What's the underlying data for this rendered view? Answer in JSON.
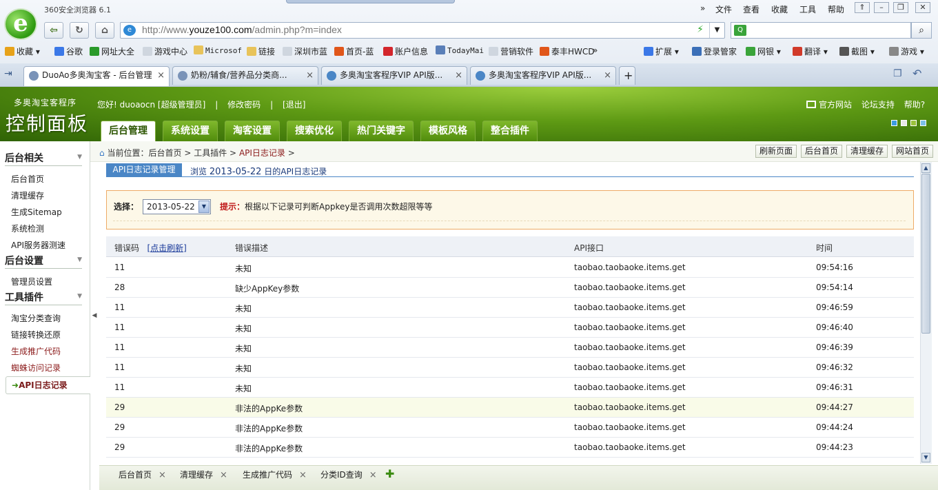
{
  "browser": {
    "app_title": "360安全浏览器 6.1",
    "menu": [
      "文件",
      "查看",
      "收藏",
      "工具",
      "帮助"
    ],
    "menu_more": "»",
    "url_gray_prefix": "http://www.",
    "url_host": "youze100.com",
    "url_path": "/admin.php?m=index",
    "bookmarks": [
      {
        "label": "收藏",
        "icon": "star-icon",
        "color": "#e7a21a"
      },
      {
        "label": "谷歌",
        "icon": "google-icon",
        "color": "#3b78e7"
      },
      {
        "label": "网址大全",
        "icon": "sites-icon",
        "color": "#2a9a2a"
      },
      {
        "label": "游戏中心",
        "icon": "page-icon",
        "color": "#cfd6df"
      },
      {
        "label": "Microsof",
        "icon": "folder-icon",
        "color": "#e8c35a"
      },
      {
        "label": "链接",
        "icon": "folder-icon",
        "color": "#e8c35a"
      },
      {
        "label": "深圳市蓝",
        "icon": "page-icon",
        "color": "#cfd6df"
      },
      {
        "label": "首页-蓝",
        "icon": "taobao-icon",
        "color": "#e0561a"
      },
      {
        "label": "账户信息",
        "icon": "diamond-icon",
        "color": "#d3262c"
      },
      {
        "label": "TodayMai",
        "icon": "shield-icon",
        "color": "#5a7fb8"
      },
      {
        "label": "营销软件",
        "icon": "page-icon",
        "color": "#cfd6df"
      },
      {
        "label": "泰丰HWCD",
        "icon": "taobao-icon",
        "color": "#e0561a"
      }
    ],
    "bookmarks_more": "»",
    "toolbar_right": [
      {
        "label": "扩展",
        "icon": "grid-icon",
        "color": "#3b78e7"
      },
      {
        "label": "登录管家",
        "icon": "key-icon",
        "color": "#3b6fb8"
      },
      {
        "label": "网银",
        "icon": "bank-icon",
        "color": "#3aa43a"
      },
      {
        "label": "翻译",
        "icon": "translate-icon",
        "color": "#d13a2a"
      },
      {
        "label": "截图",
        "icon": "scissors-icon",
        "color": "#555555"
      },
      {
        "label": "游戏",
        "icon": "gamepad-icon",
        "color": "#888888"
      }
    ],
    "tabs": [
      {
        "label": "DuoAo多奥淘宝客 - 后台管理",
        "active": true
      },
      {
        "label": "奶粉/辅食/营养品分类商...",
        "active": false
      },
      {
        "label": "多奥淘宝客程序VIP API版...",
        "active": false
      },
      {
        "label": "多奥淘宝客程序VIP API版...",
        "active": false
      }
    ],
    "tab_close": "×",
    "tab_new": "+"
  },
  "app": {
    "brand_small": "多奥淘宝客程序",
    "brand_big": "控制面板",
    "user": {
      "greeting": "您好! duoaocn [超级管理员]",
      "change_password": "修改密码",
      "logout": "[退出]"
    },
    "header_links": [
      "官方网站",
      "论坛支持",
      "帮助?"
    ],
    "main_tabs": [
      {
        "label": "后台管理",
        "active": true
      },
      {
        "label": "系统设置",
        "active": false
      },
      {
        "label": "淘客设置",
        "active": false
      },
      {
        "label": "搜索优化",
        "active": false
      },
      {
        "label": "热门关键字",
        "active": false
      },
      {
        "label": "模板风格",
        "active": false
      },
      {
        "label": "整合插件",
        "active": false
      }
    ],
    "theme_colors": [
      "#3b9be0",
      "#e8e8e8",
      "#9ac23c",
      "#7cc0e8"
    ]
  },
  "sidebar": {
    "sections": [
      {
        "title": "后台相关",
        "items": [
          "后台首页",
          "清理缓存",
          "生成Sitemap",
          "系统检测",
          "API服务器测速"
        ]
      },
      {
        "title": "后台设置",
        "items": [
          "管理员设置"
        ]
      },
      {
        "title": "工具插件",
        "items": [
          "淘宝分类查询",
          "链接转换还原",
          "生成推广代码",
          "蜘蛛访问记录",
          "API日志记录"
        ]
      }
    ],
    "active_item": "API日志记录",
    "active_prefix": "➜"
  },
  "breadcrumb": {
    "prefix": "当前位置：",
    "items": [
      "后台首页",
      ">",
      "工具插件",
      ">",
      "API日志记录",
      ">"
    ]
  },
  "quick_buttons": [
    "刷新页面",
    "后台首页",
    "清理缓存",
    "网站首页"
  ],
  "content": {
    "subtab": "API日志记录管理",
    "subtitle_prefix": "浏览",
    "subtitle_date": "2013-05-22",
    "subtitle_suffix": "日的API日志记录",
    "filter_label": "选择：",
    "selected_date": "2013-05-22",
    "hint_label": "提示：",
    "hint_text": "根据以下记录可判断Appkey是否调用次数超限等等"
  },
  "table": {
    "headers": {
      "code": "错误码",
      "refresh_link": "[点击刷新]",
      "desc": "错误描述",
      "api": "API接口",
      "time": "时间"
    },
    "rows": [
      {
        "code": "11",
        "desc": "未知",
        "api": "taobao.taobaoke.items.get",
        "time": "09:54:16"
      },
      {
        "code": "28",
        "desc": "缺少AppKey参数",
        "api": "taobao.taobaoke.items.get",
        "time": "09:54:14"
      },
      {
        "code": "11",
        "desc": "未知",
        "api": "taobao.taobaoke.items.get",
        "time": "09:46:59"
      },
      {
        "code": "11",
        "desc": "未知",
        "api": "taobao.taobaoke.items.get",
        "time": "09:46:40"
      },
      {
        "code": "11",
        "desc": "未知",
        "api": "taobao.taobaoke.items.get",
        "time": "09:46:39"
      },
      {
        "code": "11",
        "desc": "未知",
        "api": "taobao.taobaoke.items.get",
        "time": "09:46:32"
      },
      {
        "code": "11",
        "desc": "未知",
        "api": "taobao.taobaoke.items.get",
        "time": "09:46:31"
      },
      {
        "code": "29",
        "desc": "非法的AppKe参数",
        "api": "taobao.taobaoke.items.get",
        "time": "09:44:27"
      },
      {
        "code": "29",
        "desc": "非法的AppKe参数",
        "api": "taobao.taobaoke.items.get",
        "time": "09:44:24"
      },
      {
        "code": "29",
        "desc": "非法的AppKe参数",
        "api": "taobao.taobaoke.items.get",
        "time": "09:44:23"
      }
    ],
    "highlighted_row": 7
  },
  "bottom_tabs": [
    "后台首页",
    "清理缓存",
    "生成推广代码",
    "分类ID查询"
  ],
  "bottom_close": "×",
  "bottom_add": "✚"
}
